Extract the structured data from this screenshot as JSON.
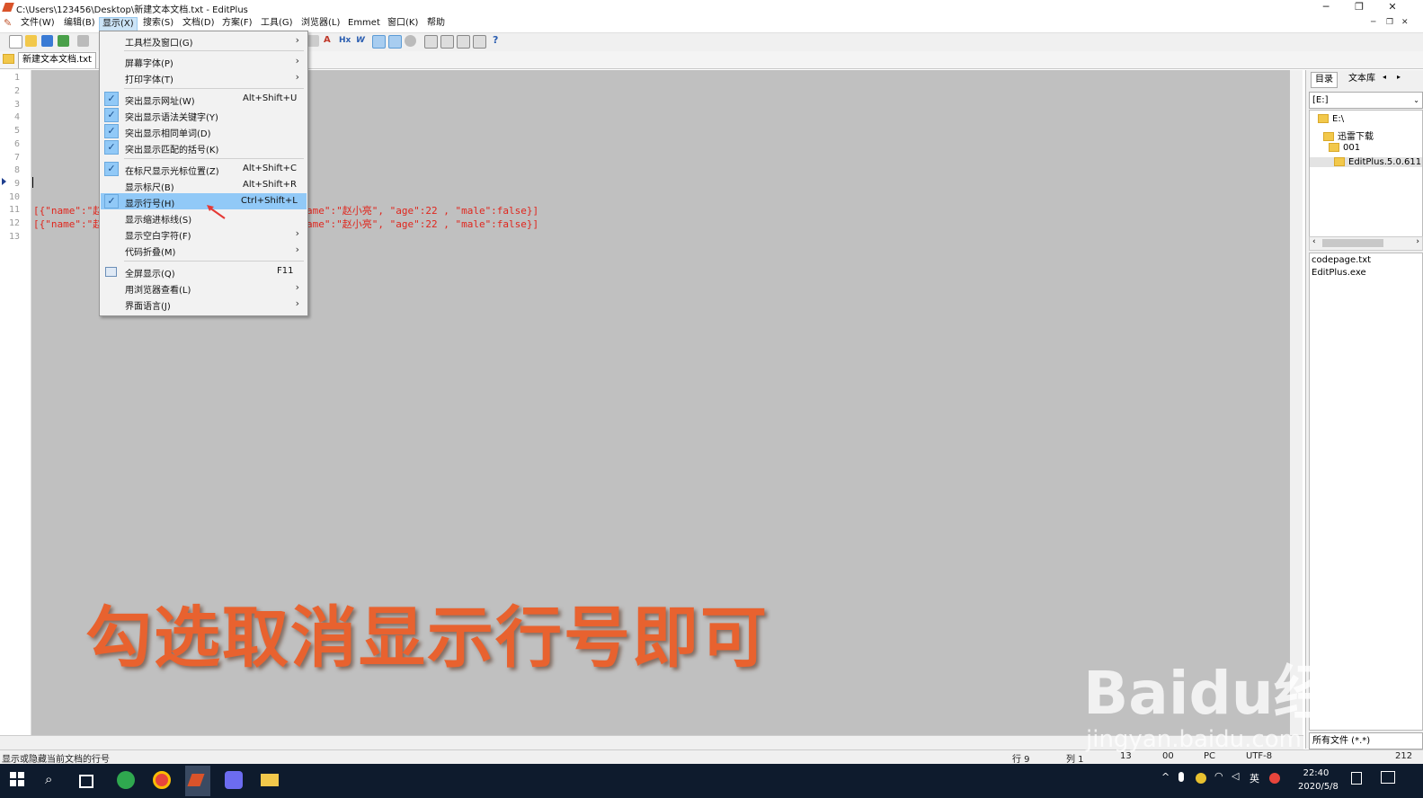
{
  "window": {
    "title": "C:\\Users\\123456\\Desktop\\新建文本文档.txt - EditPlus",
    "minimize": "─",
    "restore": "❐",
    "close": "✕"
  },
  "menubar": [
    "文件(W)",
    "编辑(B)",
    "显示(X)",
    "搜索(S)",
    "文档(D)",
    "方案(F)",
    "工具(G)",
    "浏览器(L)",
    "Emmet",
    "窗口(K)",
    "帮助"
  ],
  "tab": {
    "label": "新建文本文档.txt"
  },
  "editor": {
    "line_numbers": [
      "1",
      "2",
      "3",
      "4",
      "5",
      "6",
      "7",
      "8",
      "9",
      "10",
      "11",
      "12",
      "13"
    ],
    "line11_left": "[{\"name\":\"赵",
    "line11_right": "ame\":\"赵小亮\", \"age\":22 , \"male\":false}]",
    "line12_left": "[{\"name\":\"赵",
    "line12_right": "ame\":\"赵小亮\", \"age\":22 , \"male\":false}]"
  },
  "view_menu": {
    "items": [
      {
        "label": "工具栏及窗口(G)",
        "shortcut": "",
        "submenu": true,
        "checked": false
      },
      {
        "label": "屏幕字体(P)",
        "shortcut": "",
        "submenu": true,
        "checked": false
      },
      {
        "label": "打印字体(T)",
        "shortcut": "",
        "submenu": true,
        "checked": false
      },
      {
        "label": "突出显示网址(W)",
        "shortcut": "Alt+Shift+U",
        "submenu": false,
        "checked": true
      },
      {
        "label": "突出显示语法关键字(Y)",
        "shortcut": "",
        "submenu": false,
        "checked": true
      },
      {
        "label": "突出显示相同单词(D)",
        "shortcut": "",
        "submenu": false,
        "checked": true
      },
      {
        "label": "突出显示匹配的括号(K)",
        "shortcut": "",
        "submenu": false,
        "checked": true
      },
      {
        "label": "在标尺显示光标位置(Z)",
        "shortcut": "Alt+Shift+C",
        "submenu": false,
        "checked": true
      },
      {
        "label": "显示标尺(B)",
        "shortcut": "Alt+Shift+R",
        "submenu": false,
        "checked": false
      },
      {
        "label": "显示行号(H)",
        "shortcut": "Ctrl+Shift+L",
        "submenu": false,
        "checked": true
      },
      {
        "label": "显示缩进标线(S)",
        "shortcut": "",
        "submenu": false,
        "checked": false
      },
      {
        "label": "显示空白字符(F)",
        "shortcut": "",
        "submenu": true,
        "checked": false
      },
      {
        "label": "代码折叠(M)",
        "shortcut": "",
        "submenu": true,
        "checked": false
      },
      {
        "label": "全屏显示(Q)",
        "shortcut": "F11",
        "submenu": false,
        "checked": false
      },
      {
        "label": "用浏览器查看(L)",
        "shortcut": "",
        "submenu": true,
        "checked": false
      },
      {
        "label": "界面语言(J)",
        "shortcut": "",
        "submenu": true,
        "checked": false
      }
    ]
  },
  "right_panel": {
    "tabs": [
      "目录",
      "文本库"
    ],
    "drive": "[E:]",
    "tree": [
      "E:\\",
      "迅雷下载",
      "001",
      "EditPlus.5.0.611"
    ],
    "files": [
      "codepage.txt",
      "EditPlus.exe"
    ],
    "filter": "所有文件 (*.*)"
  },
  "status": {
    "hint": "显示或隐藏当前文档的行号",
    "row": "行 9",
    "col": "列 1",
    "lines": "13",
    "ovr": "00",
    "mode": "PC",
    "encoding": "UTF-8",
    "extra": "212"
  },
  "taskbar": {
    "time": "22:40",
    "date": "2020/5/8",
    "ime": "英"
  },
  "overlay": {
    "caption": "勾选取消显示行号即可",
    "watermark": "Baidu经验",
    "watermark_url": "jingyan.baidu.com"
  },
  "colors": {
    "selection": "#91c9f7",
    "code_red": "#e0261d",
    "caption": "#e8622f",
    "editor_bg": "#c0c0c0"
  }
}
